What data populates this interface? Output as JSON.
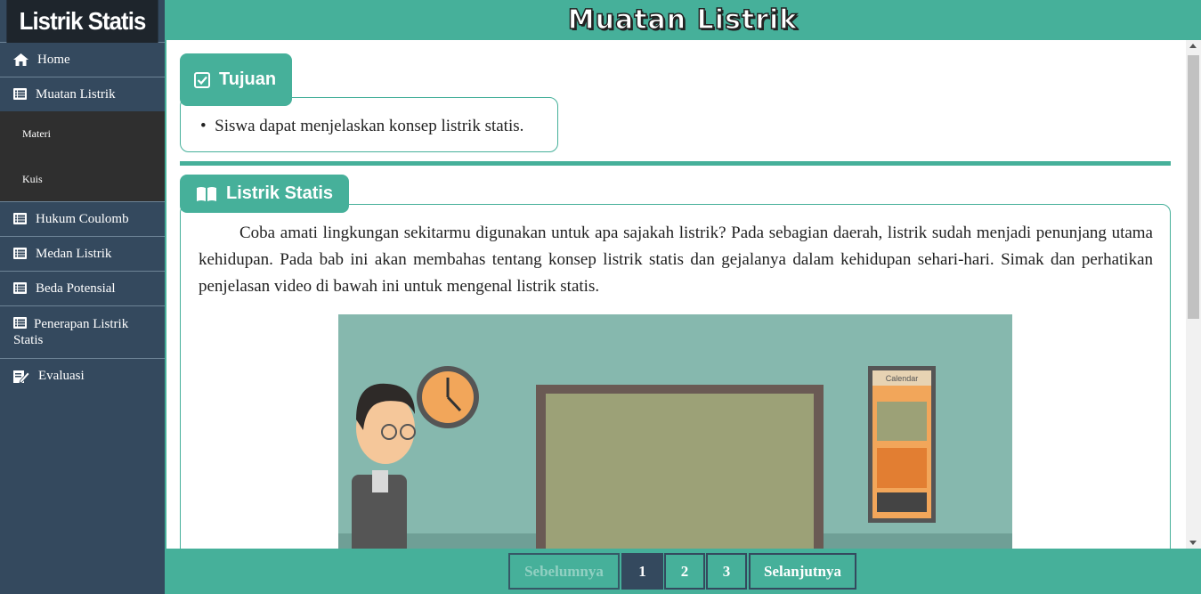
{
  "sidebar": {
    "brand": "Listrik Statis",
    "items": [
      {
        "label": "Home",
        "icon": "home-icon"
      },
      {
        "label": "Muatan Listrik",
        "icon": "list-icon"
      },
      {
        "label": "Hukum Coulomb",
        "icon": "list-icon"
      },
      {
        "label": "Medan Listrik",
        "icon": "list-icon"
      },
      {
        "label": "Beda Potensial",
        "icon": "list-icon"
      },
      {
        "label": "Penerapan Listrik Statis",
        "icon": "list-icon"
      },
      {
        "label": "Evaluasi",
        "icon": "edit-icon"
      }
    ],
    "submenu": [
      "Materi",
      "Kuis"
    ]
  },
  "header": {
    "title": "Muatan Listrik"
  },
  "main": {
    "tujuan": {
      "heading": "Tujuan",
      "items": [
        "Siswa dapat menjelaskan konsep listrik statis."
      ]
    },
    "listrik_statis": {
      "heading": "Listrik Statis",
      "paragraph": "Coba amati lingkungan sekitarmu digunakan untuk apa sajakah listrik? Pada sebagian daerah, listrik sudah menjadi penunjang utama kehidupan. Pada bab ini akan membahas tentang konsep listrik statis dan gejalanya dalam kehidupan sehari-hari. Simak dan perhatikan penjelasan video di bawah ini untuk mengenal listrik statis."
    },
    "video": {
      "calendar_label": "Calendar"
    }
  },
  "pagination": {
    "prev": "Sebelumnya",
    "pages": [
      "1",
      "2",
      "3"
    ],
    "active_page": "1",
    "next": "Selanjutnya"
  },
  "colors": {
    "accent": "#46b09a",
    "sidebar": "#34495e",
    "brand_bg": "#1e252c"
  }
}
